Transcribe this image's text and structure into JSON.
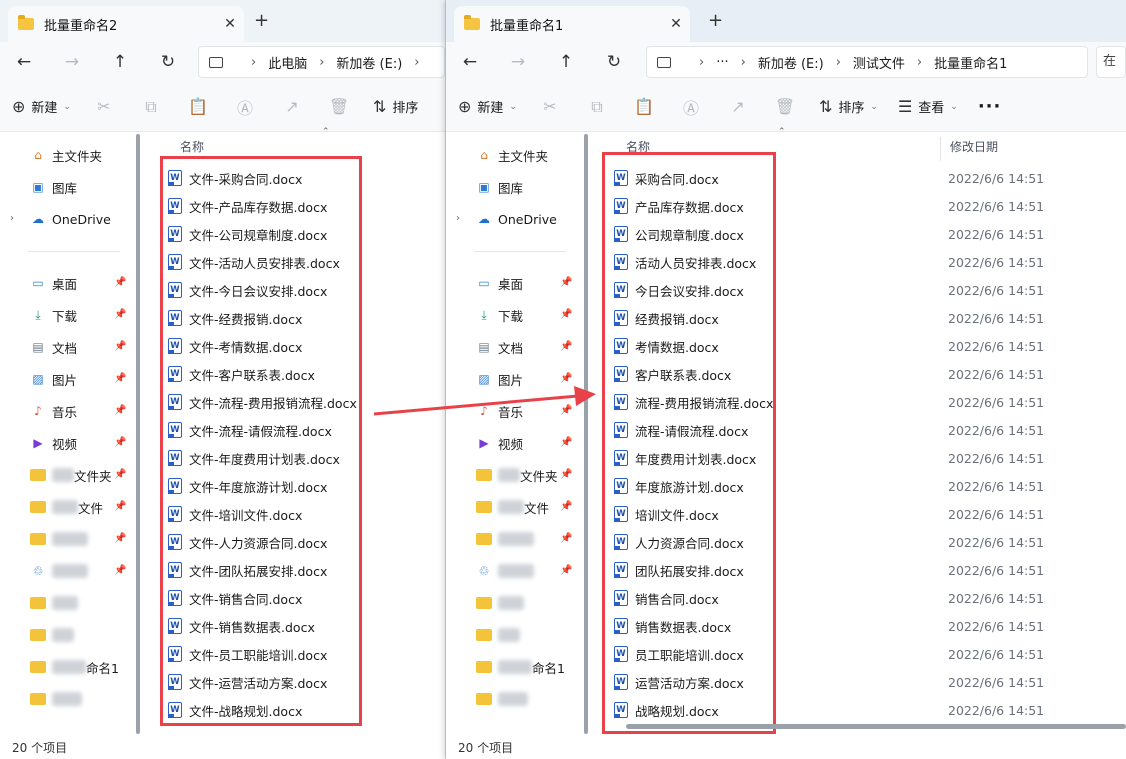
{
  "left": {
    "tab_title": "批量重命名2",
    "address": [
      "此电脑",
      "新加卷 (E:)"
    ],
    "cmd_new": "新建",
    "cmd_sort": "排序",
    "column_name": "名称",
    "nav": {
      "home": "主文件夹",
      "gallery": "图库",
      "onedrive": "OneDrive",
      "desktop": "桌面",
      "downloads": "下载",
      "documents": "文档",
      "pictures": "图片",
      "music": "音乐",
      "videos": "视频",
      "partial1": "文件夹",
      "partial2": "文件",
      "partial3": "命名1"
    },
    "files": [
      "文件-采购合同.docx",
      "文件-产品库存数据.docx",
      "文件-公司规章制度.docx",
      "文件-活动人员安排表.docx",
      "文件-今日会议安排.docx",
      "文件-经费报销.docx",
      "文件-考情数据.docx",
      "文件-客户联系表.docx",
      "文件-流程-费用报销流程.docx",
      "文件-流程-请假流程.docx",
      "文件-年度费用计划表.docx",
      "文件-年度旅游计划.docx",
      "文件-培训文件.docx",
      "文件-人力资源合同.docx",
      "文件-团队拓展安排.docx",
      "文件-销售合同.docx",
      "文件-销售数据表.docx",
      "文件-员工职能培训.docx",
      "文件-运营活动方案.docx",
      "文件-战略规划.docx"
    ],
    "status": "20 个项目"
  },
  "right": {
    "tab_title": "批量重命名1",
    "address": [
      "新加卷 (E:)",
      "测试文件",
      "批量重命名1"
    ],
    "address_more": "···",
    "search_stub": "在",
    "cmd_new": "新建",
    "cmd_sort": "排序",
    "cmd_view": "查看",
    "column_name": "名称",
    "column_date": "修改日期",
    "nav": {
      "home": "主文件夹",
      "gallery": "图库",
      "onedrive": "OneDrive",
      "desktop": "桌面",
      "downloads": "下载",
      "documents": "文档",
      "pictures": "图片",
      "music": "音乐",
      "videos": "视频",
      "partial1": "文件夹",
      "partial2": "文件",
      "partial3": "命名1"
    },
    "files": [
      "采购合同.docx",
      "产品库存数据.docx",
      "公司规章制度.docx",
      "活动人员安排表.docx",
      "今日会议安排.docx",
      "经费报销.docx",
      "考情数据.docx",
      "客户联系表.docx",
      "流程-费用报销流程.docx",
      "流程-请假流程.docx",
      "年度费用计划表.docx",
      "年度旅游计划.docx",
      "培训文件.docx",
      "人力资源合同.docx",
      "团队拓展安排.docx",
      "销售合同.docx",
      "销售数据表.docx",
      "员工职能培训.docx",
      "运营活动方案.docx",
      "战略规划.docx"
    ],
    "modified": "2022/6/6 14:51",
    "status": "20 个项目"
  },
  "colors": {
    "highlight": "#e8414a",
    "word_blue": "#2b5fc3",
    "folder": "#f4c33c"
  }
}
